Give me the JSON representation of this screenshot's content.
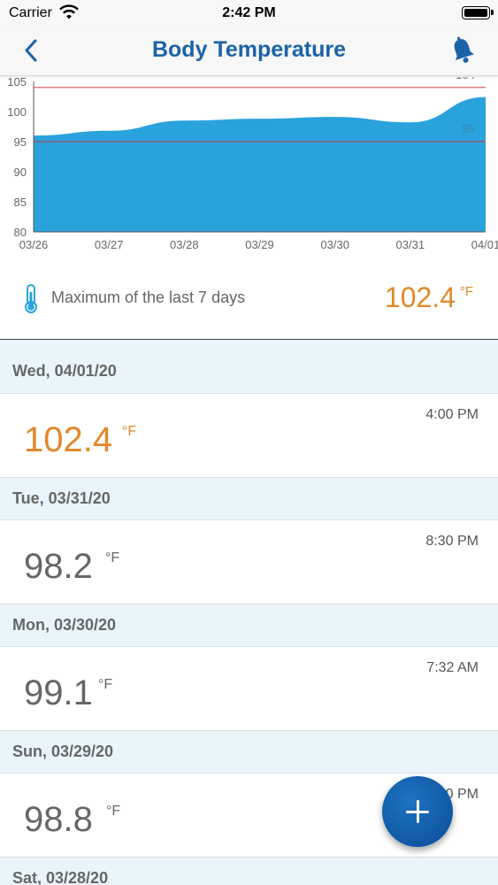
{
  "status_bar": {
    "carrier": "Carrier",
    "time": "2:42 PM"
  },
  "nav": {
    "title": "Body Temperature",
    "back_icon": "chevron-left-icon",
    "bell_icon": "bell-icon"
  },
  "chart_data": {
    "type": "area",
    "x": [
      "03/26",
      "03/27",
      "03/28",
      "03/29",
      "03/30",
      "03/31",
      "04/01"
    ],
    "values": [
      96.0,
      96.8,
      98.5,
      98.8,
      99.1,
      98.2,
      102.4
    ],
    "ylim": [
      80,
      105
    ],
    "yticks": [
      80,
      85,
      90,
      95,
      100,
      105
    ],
    "reference_lines": [
      {
        "label": "104",
        "value": 104,
        "color": "#d9534f"
      },
      {
        "label": "95",
        "value": 95,
        "color": "#a04d5b"
      }
    ],
    "fill_color": "#2aa3dd",
    "grid": false
  },
  "max_row": {
    "label": "Maximum of the last 7 days",
    "value": "102.4",
    "unit": "°F",
    "icon": "thermometer-icon"
  },
  "entries": [
    {
      "date": "Wed, 04/01/20",
      "temp": "102.4",
      "unit": "°F",
      "time": "4:00 PM",
      "high": true
    },
    {
      "date": "Tue, 03/31/20",
      "temp": "98.2",
      "unit": "°F",
      "time": "8:30 PM",
      "high": false
    },
    {
      "date": "Mon, 03/30/20",
      "temp": "99.1",
      "unit": "°F",
      "time": "7:32 AM",
      "high": false
    },
    {
      "date": "Sun, 03/29/20",
      "temp": "98.8",
      "unit": "°F",
      "time": "8:30 PM",
      "high": false
    },
    {
      "date": "Sat, 03/28/20"
    }
  ],
  "fab": {
    "icon": "plus-icon"
  },
  "colors": {
    "accent": "#1a63a8",
    "high_temp": "#e0882a",
    "header_bg": "#eaf5fb"
  }
}
